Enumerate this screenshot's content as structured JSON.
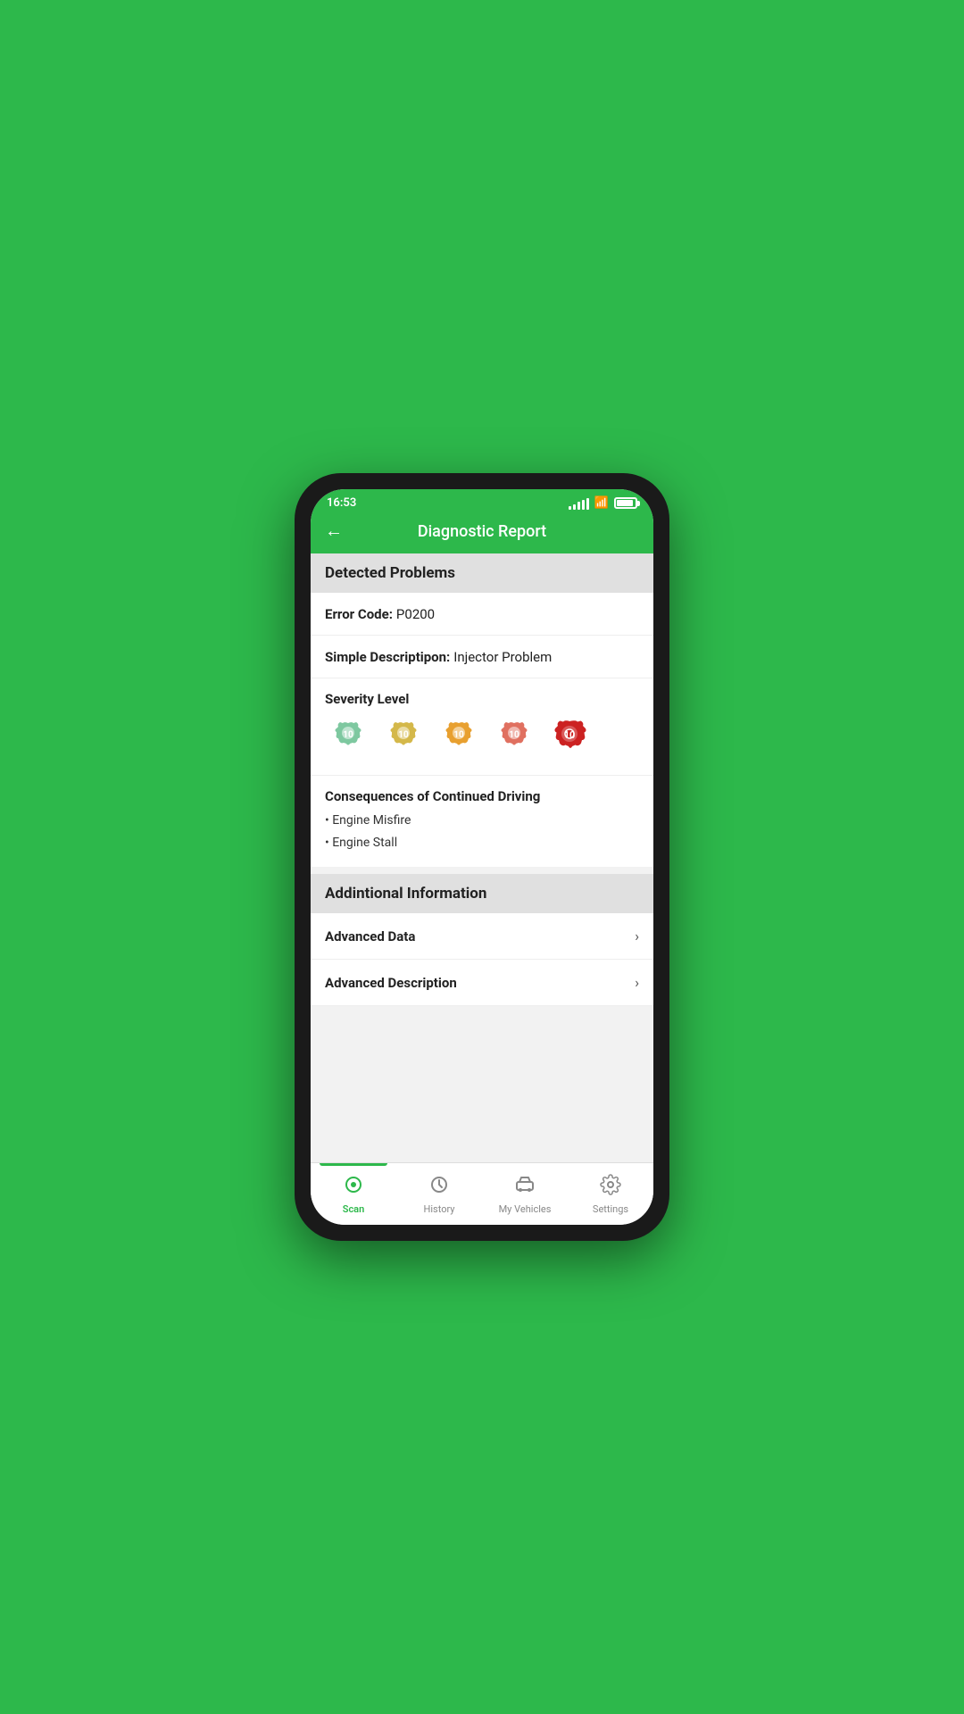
{
  "status_bar": {
    "time": "16:53"
  },
  "header": {
    "title": "Diagnostic Report",
    "back_label": "←"
  },
  "detected_problems": {
    "section_title": "Detected Problems",
    "error_code_label": "Error Code:",
    "error_code_value": "P0200",
    "simple_desc_label": "Simple Descriptipon:",
    "simple_desc_value": "Injector Problem",
    "severity_label": "Severity Level",
    "severity_levels": [
      {
        "color": "#7ec8a0",
        "active": false
      },
      {
        "color": "#d4b84a",
        "active": false
      },
      {
        "color": "#e8a030",
        "active": false
      },
      {
        "color": "#e07060",
        "active": false
      },
      {
        "color": "#cc2222",
        "active": true
      }
    ],
    "consequences_title": "Consequences of Continued Driving",
    "consequences": [
      "Engine Misfire",
      "Engine Stall"
    ]
  },
  "additional_information": {
    "section_title": "Addintional Information",
    "items": [
      {
        "label": "Advanced Data"
      },
      {
        "label": "Advanced Description"
      }
    ]
  },
  "bottom_nav": {
    "items": [
      {
        "label": "Scan",
        "active": true
      },
      {
        "label": "History",
        "active": false
      },
      {
        "label": "My Vehicles",
        "active": false
      },
      {
        "label": "Settings",
        "active": false
      }
    ]
  }
}
